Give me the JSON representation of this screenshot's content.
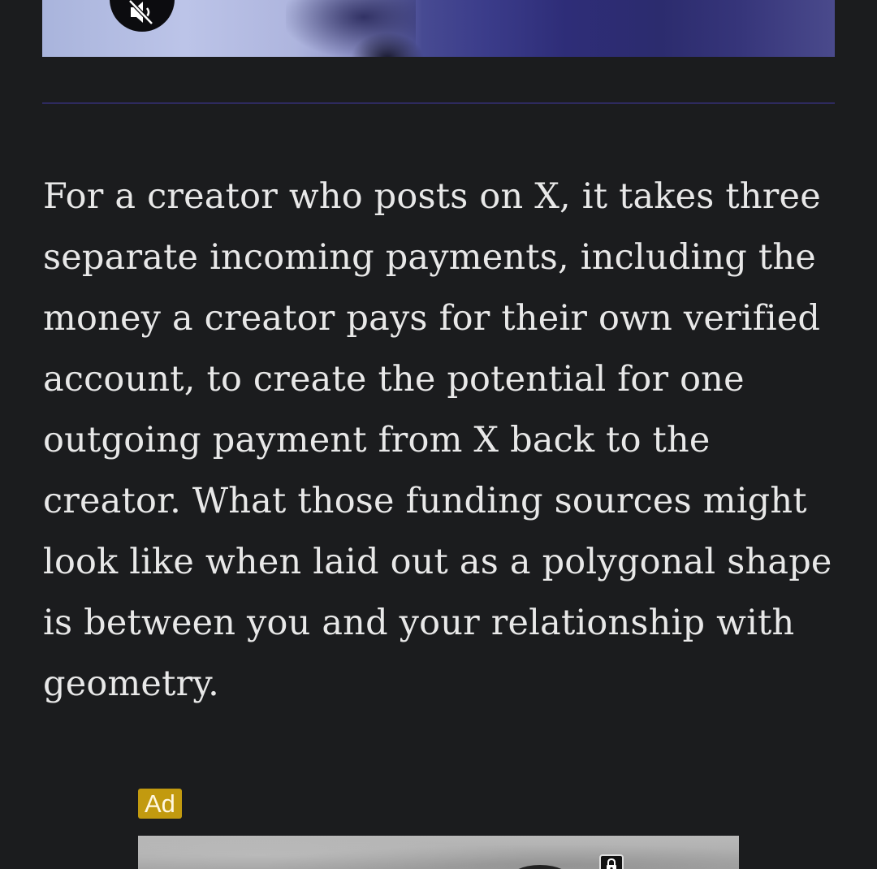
{
  "video": {
    "mute_icon": "speaker-muted-icon"
  },
  "article": {
    "paragraph": "For a creator who posts on X, it takes three separate incoming payments, including the money a creator pays for their own verified account, to create the potential for one outgoing payment from X back to the creator. What those funding sources might look like when laid out as a polygonal shape is between you and your relationship with geometry."
  },
  "ad": {
    "label": "Ad",
    "badge_color": "#c29a0f",
    "icon": "lock-icon"
  },
  "colors": {
    "background": "#1b1c1e",
    "text": "#e8e8e8",
    "divider": "#2e2a5e"
  }
}
